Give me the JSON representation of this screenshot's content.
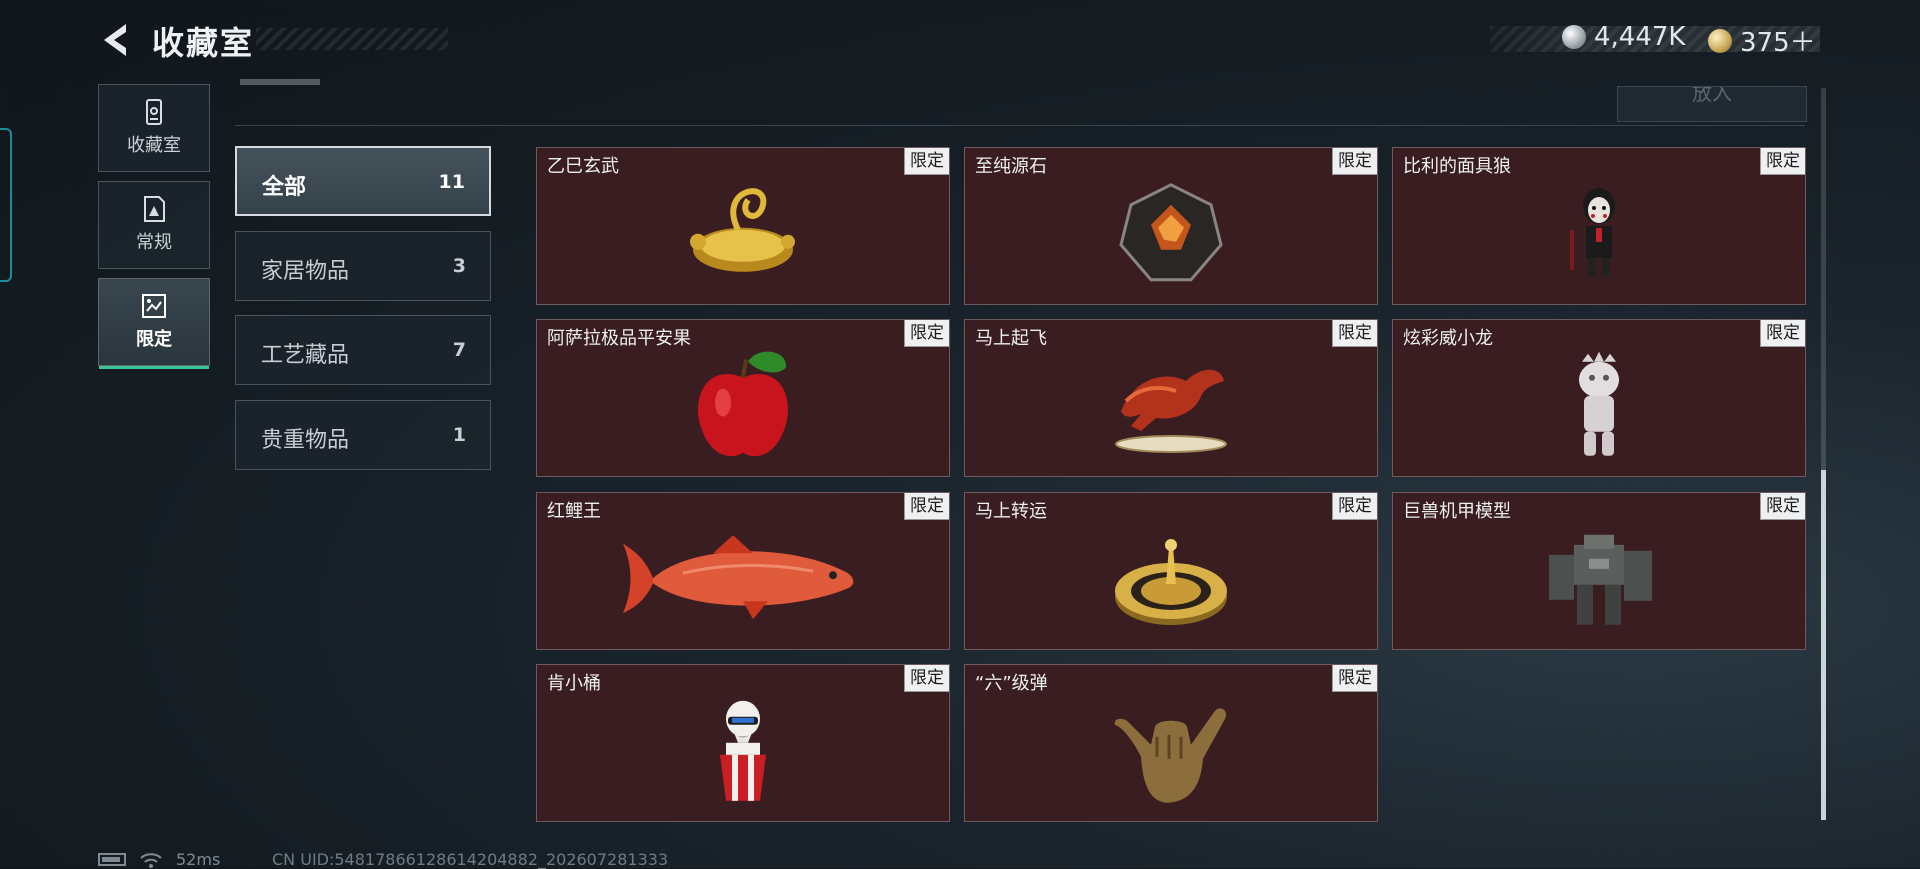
{
  "header": {
    "title": "收藏室",
    "back_icon": "back-arrow-icon"
  },
  "currency": [
    {
      "icon": "silver-coin-icon",
      "value": "4,447K"
    },
    {
      "icon": "gold-coin-icon",
      "value": "375＋"
    }
  ],
  "nav": [
    {
      "label": "收藏室",
      "icon": "collection-room-icon",
      "active": false
    },
    {
      "label": "常规",
      "icon": "regular-icon",
      "active": false
    },
    {
      "label": "限定",
      "icon": "limited-icon",
      "active": true
    }
  ],
  "put_button": "放入",
  "categories": [
    {
      "name": "全部",
      "count": "11",
      "active": true
    },
    {
      "name": "家居物品",
      "count": "3",
      "active": false
    },
    {
      "name": "工艺藏品",
      "count": "7",
      "active": false
    },
    {
      "name": "贵重物品",
      "count": "1",
      "active": false
    }
  ],
  "items": [
    {
      "name": "乙巳玄武",
      "tag": "限定",
      "icon": "golden-snake-tortoise-icon"
    },
    {
      "name": "至纯源石",
      "tag": "限定",
      "icon": "crystal-stone-icon"
    },
    {
      "name": "比利的面具狼",
      "tag": "限定",
      "icon": "masked-puppet-icon"
    },
    {
      "name": "阿萨拉极品平安果",
      "tag": "限定",
      "icon": "red-apple-icon"
    },
    {
      "name": "马上起飞",
      "tag": "限定",
      "icon": "flying-horse-icon"
    },
    {
      "name": "炫彩威小龙",
      "tag": "限定",
      "icon": "dragon-figurine-icon"
    },
    {
      "name": "红鲤王",
      "tag": "限定",
      "icon": "red-carp-icon"
    },
    {
      "name": "马上转运",
      "tag": "限定",
      "icon": "golden-spinner-icon"
    },
    {
      "name": "巨兽机甲模型",
      "tag": "限定",
      "icon": "mech-model-icon"
    },
    {
      "name": "肯小桶",
      "tag": "限定",
      "icon": "bucket-figure-icon"
    },
    {
      "name": "“六”级弹",
      "tag": "限定",
      "icon": "shaka-hand-icon"
    }
  ],
  "status": {
    "ping": "52ms",
    "uid": "CN UID:54817866128614204882_202607281333"
  },
  "colors": {
    "card_bg": "#3a1d20",
    "accent_green": "#39c79a",
    "left_accent": "#1f8c99"
  }
}
